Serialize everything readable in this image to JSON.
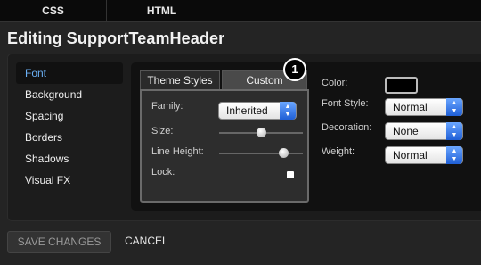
{
  "topbar": {
    "tabs": [
      "CSS",
      "HTML"
    ]
  },
  "title": "Editing SupportTeamHeader",
  "nav": {
    "items": [
      "Font",
      "Background",
      "Spacing",
      "Borders",
      "Shadows",
      "Visual FX"
    ],
    "active": "Font"
  },
  "tabs": {
    "theme_styles": "Theme Styles",
    "custom": "Custom"
  },
  "badge": "1",
  "custom": {
    "family_label": "Family:",
    "family_value": "Inherited",
    "size_label": "Size:",
    "size_level": 0.5,
    "line_height_label": "Line Height:",
    "line_height_level": 0.77,
    "lock_label": "Lock:"
  },
  "right": {
    "color_label": "Color:",
    "color_value": "#000000",
    "font_style_label": "Font Style:",
    "font_style_value": "Normal",
    "decoration_label": "Decoration:",
    "decoration_value": "None",
    "weight_label": "Weight:",
    "weight_value": "Normal"
  },
  "actions": {
    "save": "SAVE CHANGES",
    "cancel": "CANCEL"
  },
  "colors": {
    "accent": "#6bb0f5",
    "select_arrow": "#2f72e8"
  }
}
